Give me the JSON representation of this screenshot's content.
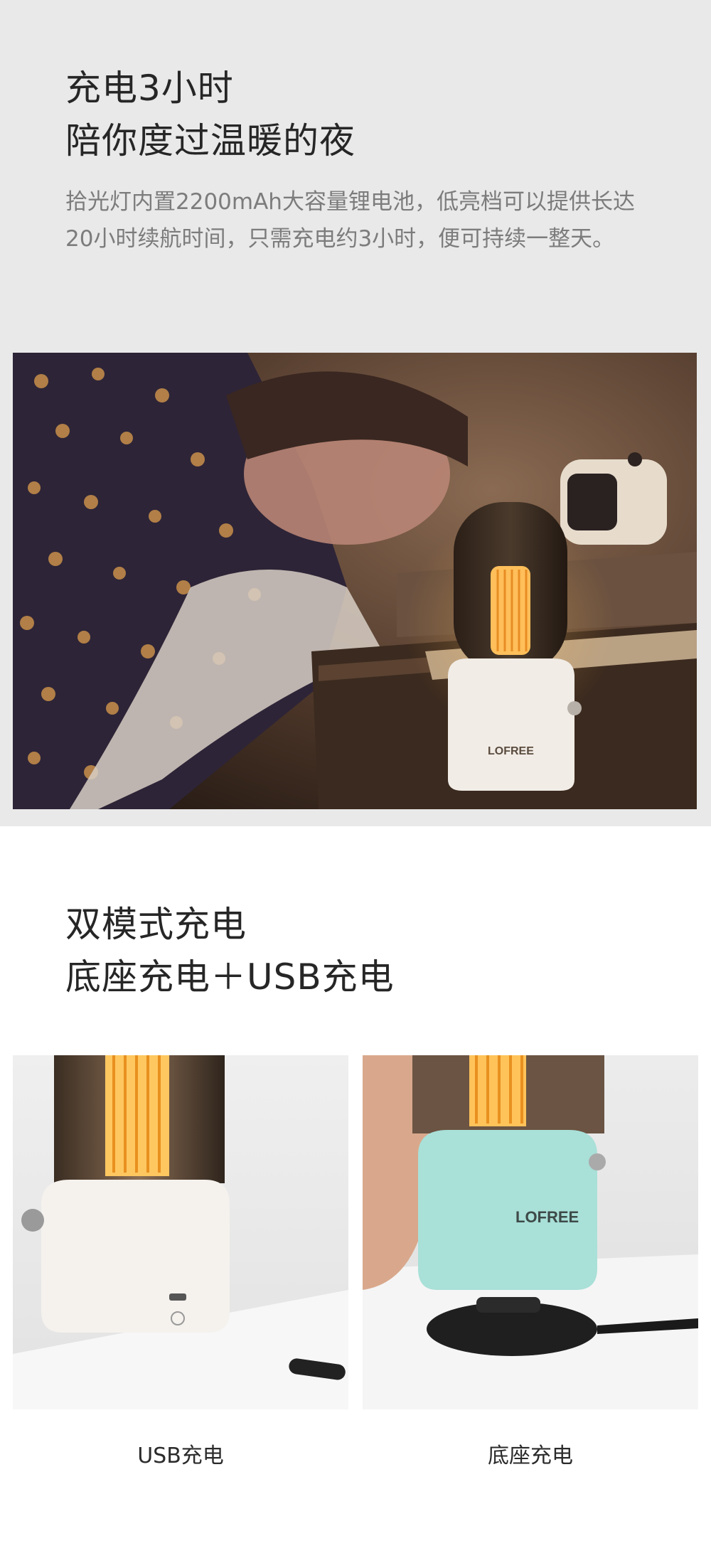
{
  "section1": {
    "title_line1": "充电3小时",
    "title_line2": "陪你度过温暖的夜",
    "body": "拾光灯内置2200mAh大容量锂电池，低亮档可以提供长达20小时续航时间，只需充电约3小时，便可持续一整天。"
  },
  "photo1": {
    "lamp_logo": "LOFREE"
  },
  "section2": {
    "title_line1": "双模式充电",
    "title_line2": "底座充电＋USB充电"
  },
  "photos2": [
    {
      "caption": "USB充电"
    },
    {
      "caption": "底座充电",
      "lamp_logo": "LOFREE"
    }
  ]
}
